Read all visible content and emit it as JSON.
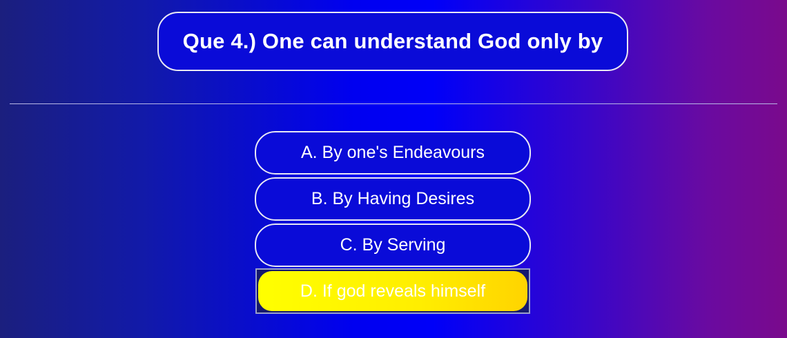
{
  "question": {
    "text": "Que 4.) One can understand God only by"
  },
  "options": [
    {
      "label": "A. By one's Endeavours",
      "selected": false
    },
    {
      "label": "B. By Having Desires",
      "selected": false
    },
    {
      "label": "C. By Serving",
      "selected": false
    },
    {
      "label": "D. If god reveals himself",
      "selected": true
    }
  ],
  "colors": {
    "background_left": "#1b1f7e",
    "background_center": "#0000f0",
    "background_right": "#7a0a8c",
    "option_fill": "#0a0bd8",
    "option_border": "#e8e8f4",
    "selected_fill": "#ffff00",
    "text": "#ffffff"
  }
}
